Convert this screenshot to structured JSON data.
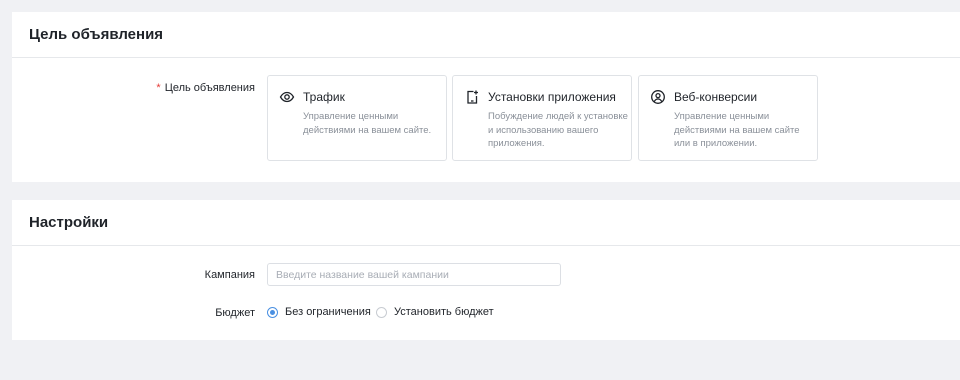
{
  "objective": {
    "header": "Цель объявления",
    "field_label": "Цель объявления",
    "required_mark": "*",
    "options": [
      {
        "title": "Трафик",
        "description": "Управление ценными действиями на вашем сайте.",
        "icon": "eye-icon"
      },
      {
        "title": "Установки приложения",
        "description": "Побуждение людей к установке и использованию вашего приложения.",
        "icon": "app-install-icon"
      },
      {
        "title": "Веб-конверсии",
        "description": "Управление ценными действиями на вашем сайте или в приложении.",
        "icon": "user-circle-icon"
      }
    ]
  },
  "settings": {
    "header": "Настройки",
    "campaign": {
      "label": "Кампания",
      "placeholder": "Введите название вашей кампании",
      "value": ""
    },
    "budget": {
      "label": "Бюджет",
      "options": [
        {
          "label": "Без ограничения",
          "selected": true
        },
        {
          "label": "Установить бюджет",
          "selected": false
        }
      ]
    }
  },
  "colors": {
    "accent": "#4a90e2",
    "required": "#e53935",
    "background": "#f0f1f4"
  }
}
